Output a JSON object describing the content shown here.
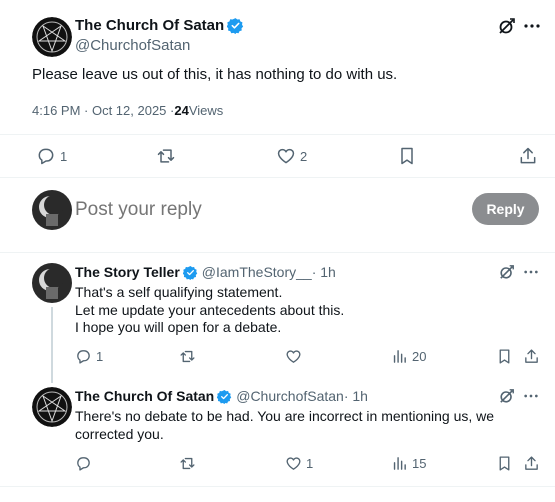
{
  "main_tweet": {
    "author_name": "The Church Of Satan",
    "author_handle": "@ChurchofSatan",
    "text": "Please leave us out of this, it has nothing to do with us.",
    "time": "4:16 PM · Oct 12, 2025 · ",
    "views_count": "24",
    "views_label": " Views",
    "actions": {
      "replies": "1",
      "retweets": "",
      "likes": "2"
    }
  },
  "composer": {
    "placeholder": "Post your reply",
    "reply_button": "Reply"
  },
  "replies": [
    {
      "author_name": "The Story Teller",
      "author_handle": "@IamTheStory__",
      "time": " · 1h",
      "lines": [
        "That's a self qualifying statement.",
        "Let me update your antecedents about this.",
        "I hope you will open for a debate."
      ],
      "actions": {
        "replies": "1",
        "retweets": "",
        "likes": "",
        "views": "20"
      }
    },
    {
      "author_name": "The Church Of Satan",
      "author_handle": "@ChurchofSatan",
      "time": " · 1h",
      "lines": [
        "There's no debate to be had. You are incorrect in mentioning us, we",
        "corrected you."
      ],
      "actions": {
        "replies": "",
        "retweets": "",
        "likes": "1",
        "views": "15"
      }
    }
  ],
  "colors": {
    "verified": "#1d9bf0",
    "reply_button_bg": "#8b8d90",
    "text": "#0f1419",
    "muted": "#536471"
  }
}
